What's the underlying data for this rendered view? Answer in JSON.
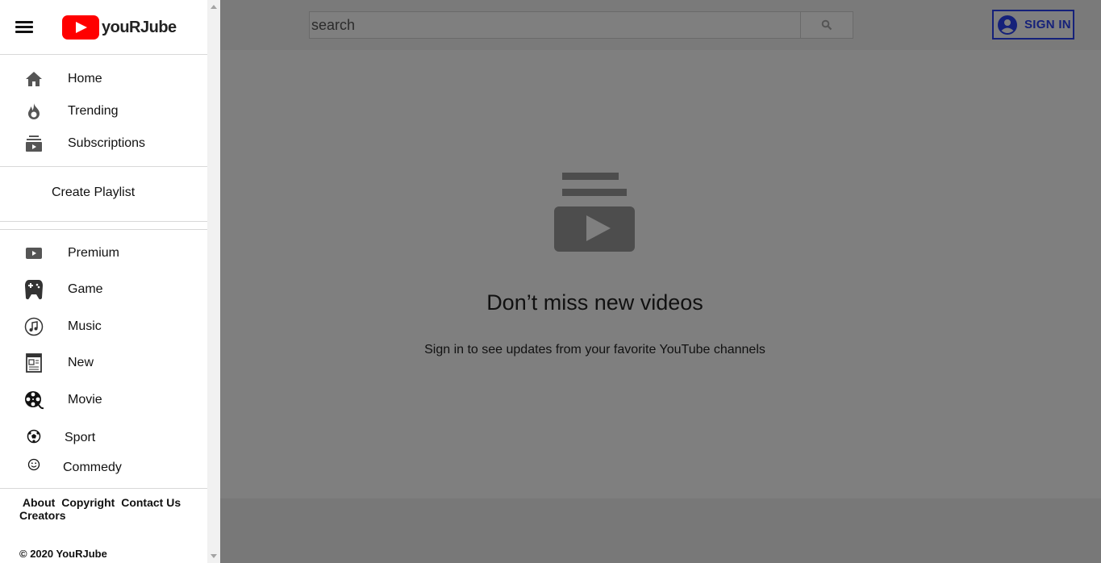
{
  "app": {
    "logo_text": "youRJube"
  },
  "header": {
    "search_placeholder": "search",
    "signin_label": "SIGN IN"
  },
  "sidebar": {
    "primary": [
      {
        "label": "Home",
        "icon": "home-icon"
      },
      {
        "label": "Trending",
        "icon": "fire-icon"
      },
      {
        "label": "Subscriptions",
        "icon": "subscriptions-icon"
      }
    ],
    "create_playlist": "Create Playlist",
    "categories": [
      {
        "label": "Premium",
        "icon": "premium-icon"
      },
      {
        "label": "Game",
        "icon": "gamepad-icon"
      },
      {
        "label": "Music",
        "icon": "music-icon"
      },
      {
        "label": "New",
        "icon": "newspaper-icon"
      },
      {
        "label": "Movie",
        "icon": "film-reel-icon"
      },
      {
        "label": "Sport",
        "icon": "soccer-ball-icon"
      },
      {
        "label": "Commedy",
        "icon": "smiley-icon"
      }
    ],
    "footer_links": [
      "About",
      "Copyright",
      "Contact Us",
      "Creators"
    ],
    "copyright": "© 2020 YouRJube"
  },
  "main": {
    "title": "Don’t miss new videos",
    "subtitle": "Sign in to see updates from your favorite YouTube channels"
  },
  "colors": {
    "brand_red": "#ff0000",
    "signin_accent": "#15217a",
    "overlay_gray": "#7f7f7f"
  }
}
